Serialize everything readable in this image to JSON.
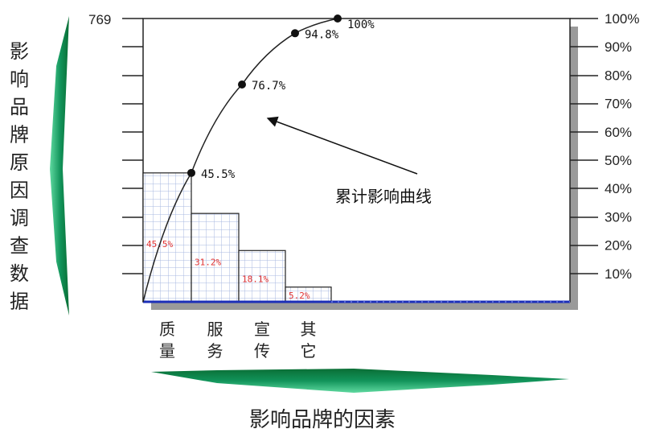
{
  "chart_data": {
    "type": "bar",
    "title": "",
    "categories": [
      "质量",
      "服务",
      "宣传",
      "其它"
    ],
    "category_lines": [
      [
        "质",
        "量"
      ],
      [
        "服",
        "务"
      ],
      [
        "宣",
        "传"
      ],
      [
        "其",
        "它"
      ]
    ],
    "bar_values": [
      45.5,
      31.2,
      18.1,
      5.2
    ],
    "bar_labels": [
      "45.5%",
      "31.2%",
      "18.1%",
      "5.2%"
    ],
    "cumulative_values": [
      45.5,
      76.7,
      94.8,
      100
    ],
    "cumulative_labels": [
      "45.5%",
      "76.7%",
      "94.8%",
      "100%"
    ],
    "left_axis_top_label": "769",
    "right_axis_labels": [
      "10%",
      "20%",
      "30%",
      "40%",
      "50%",
      "60%",
      "70%",
      "80%",
      "90%",
      "100%"
    ],
    "ylim_percent": [
      0,
      100
    ],
    "ylabel": "影响品牌原因调查数据",
    "xlabel": "影响品牌的因素",
    "annotation": "累计影响曲线",
    "grid": false,
    "legend": "none"
  },
  "colors": {
    "bar_fill": "#ffffff",
    "bar_grid": "#a8b8e0",
    "bar_border": "#222222",
    "baseline": "#1c2fb8",
    "arrow_green_dark": "#0a7a3c",
    "arrow_green_light": "#5fd9a0",
    "shadow": "#9a9a9a",
    "bar_label": "#e03030"
  }
}
